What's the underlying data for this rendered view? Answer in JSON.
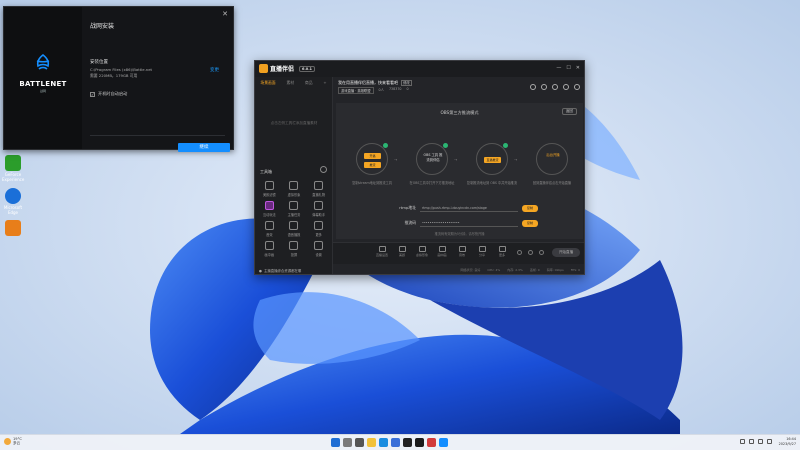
{
  "desktop": {
    "icons": [
      {
        "label": "GeForce Experience",
        "color": "#2b9d2b"
      },
      {
        "label": "Microsoft Edge",
        "color": "#1a6fd8"
      },
      {
        "label": "",
        "color": "#e87e1a"
      }
    ]
  },
  "battlenet": {
    "title": "战网安装",
    "close": "✕",
    "logo_word": "BATTLENET",
    "logo_sub": "战网",
    "install_label": "安装位置",
    "install_path": "C:\\Program Files (x86)\\Battle.net",
    "install_space": "需要 220MB，179GB 可用",
    "change_label": "变更",
    "autostart_label": "开机时自动启动",
    "autostart_checked": "✓",
    "continue_label": "继续"
  },
  "app": {
    "brand": "直播伴侣",
    "version": "6.0.1",
    "left_tabs": [
      "场景画面",
      "素材",
      "商品",
      "+"
    ],
    "empty_hint": "点击左侧工具栏添加直播素材",
    "tools_header": "工具箱",
    "tools": [
      {
        "label": "美颜滤镜"
      },
      {
        "label": "虚拟形象"
      },
      {
        "label": "直播礼物"
      },
      {
        "label": "互动玩法"
      },
      {
        "label": "主播任务"
      },
      {
        "label": "弹幕助手"
      },
      {
        "label": "音效"
      },
      {
        "label": "语音播报"
      },
      {
        "label": "更多"
      },
      {
        "label": "画中画"
      },
      {
        "label": "投屏"
      },
      {
        "label": "设置"
      }
    ],
    "left_footer": "主播直播综合资源都在哪",
    "room_title": "我在用直播伴侣直播，快来看看吧",
    "room_tag": "修改",
    "room_meta": {
      "category": "游戏直播 · 英雄联盟",
      "viewers": "0人",
      "id": "738370",
      "likes": "0"
    },
    "panel_title": "OBS第三方推流模式",
    "return_label": "返回",
    "steps": [
      {
        "chip_top": "开播",
        "chip_bottom": "推流",
        "inner": "",
        "desc": "复制stream地址到推流工具"
      },
      {
        "chip_top": "",
        "chip_bottom": "",
        "inner": "OBS 工具 推流到伴侣",
        "desc": "在OBS工具中打开下方推流地址"
      },
      {
        "chip_top": "直播推流",
        "chip_bottom": "",
        "inner": "",
        "desc": "复制推流地址到 OBS 中并开始推流"
      },
      {
        "chip_top": "",
        "chip_bottom": "",
        "inner": "后台开播",
        "desc": "回到直播伴侣点击开始直播"
      }
    ],
    "fields": [
      {
        "label": "rtmp地址",
        "value": "rtmp://push-rtmp-l.douyincdn.com/stage",
        "button": "复制"
      },
      {
        "label": "推流码",
        "value": "••••••••••••••••••••",
        "button": "复制"
      }
    ],
    "hint": "推流码有效期为5分钟，请尽快开播",
    "bottom_items": [
      "直播设置",
      "美颜",
      "虚拟形象",
      "画中画",
      "音效",
      "分享",
      "更多"
    ],
    "start_live": "开始直播",
    "status": [
      "网络状况: 良好",
      "CPU: 4%",
      "内存: 2.3%",
      "丢帧: 0",
      "码率: 0kbps",
      "FPS: 0"
    ]
  },
  "taskbar": {
    "weather_temp": "19°C",
    "weather_desc": "多云",
    "time": "16:44",
    "date": "2023/9/27",
    "apps": [
      {
        "name": "start",
        "color": "#1f6ed4"
      },
      {
        "name": "search",
        "color": "#7a7a7a"
      },
      {
        "name": "task-view",
        "color": "#555"
      },
      {
        "name": "explorer",
        "color": "#f2c23a"
      },
      {
        "name": "edge",
        "color": "#1a8de0"
      },
      {
        "name": "store",
        "color": "#3a6fd8"
      },
      {
        "name": "app-a",
        "color": "#222"
      },
      {
        "name": "app-b",
        "color": "#1b1b1b"
      },
      {
        "name": "app-c",
        "color": "#d23b3b"
      },
      {
        "name": "battlenet",
        "color": "#148eff"
      }
    ]
  }
}
